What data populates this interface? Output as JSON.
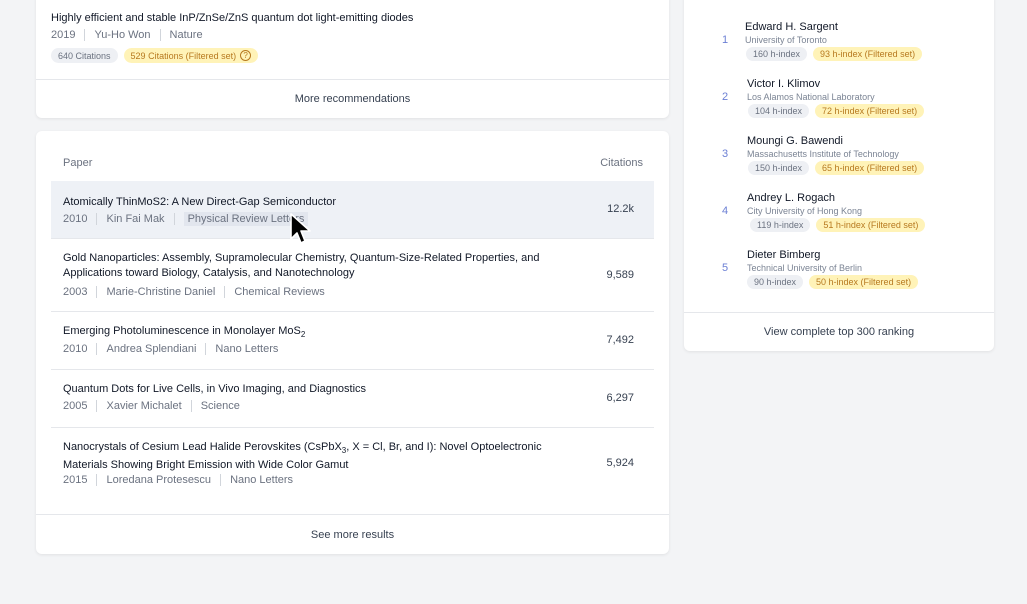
{
  "recommendation": {
    "title": "Highly efficient and stable InP/ZnSe/ZnS quantum dot light-emitting diodes",
    "year": "2019",
    "author": "Yu-Ho Won",
    "venue": "Nature",
    "citations_badge": "640 Citations",
    "filtered_badge": "529 Citations (Filtered set)",
    "help_icon": "?",
    "more_label": "More recommendations"
  },
  "papers": {
    "col_paper": "Paper",
    "col_citations": "Citations",
    "rows": [
      {
        "title": "Atomically ThinMoS2: A New Direct-Gap Semiconductor",
        "year": "2010",
        "author": "Kin Fai Mak",
        "venue": "Physical Review Letters",
        "citations": "12.2k"
      },
      {
        "title": "Gold Nanoparticles: Assembly, Supramolecular Chemistry, Quantum-Size-Related Properties, and Applications toward Biology, Catalysis, and Nanotechnology",
        "year": "2003",
        "author": "Marie-Christine Daniel",
        "venue": "Chemical Reviews",
        "citations": "9,589"
      },
      {
        "title_prefix": "Emerging Photoluminescence in Monolayer MoS",
        "title_sub": "2",
        "year": "2010",
        "author": "Andrea Splendiani",
        "venue": "Nano Letters",
        "citations": "7,492"
      },
      {
        "title": "Quantum Dots for Live Cells, in Vivo Imaging, and Diagnostics",
        "year": "2005",
        "author": "Xavier Michalet",
        "venue": "Science",
        "citations": "6,297"
      },
      {
        "title_line1_a": "Nanocrystals of Cesium Lead Halide Perovskites (CsPbX",
        "title_line1_sub": "3",
        "title_line1_b": ", X = Cl, Br, and I): Novel Optoelectronic",
        "title_line2": "Materials Showing Bright Emission with Wide Color Gamut",
        "year": "2015",
        "author": "Loredana Protesescu",
        "venue": "Nano Letters",
        "citations": "5,924"
      }
    ],
    "see_more_label": "See more results"
  },
  "ranking": {
    "items": [
      {
        "rank": "1",
        "name": "Edward H. Sargent",
        "affiliation": "University of Toronto",
        "hindex": "160 h-index",
        "filtered": "93 h-index (Filtered set)"
      },
      {
        "rank": "2",
        "name": "Victor I. Klimov",
        "affiliation": "Los Alamos National Laboratory",
        "hindex": "104 h-index",
        "filtered": "72 h-index (Filtered set)"
      },
      {
        "rank": "3",
        "name": "Moungi G. Bawendi",
        "affiliation": "Massachusetts Institute of Technology",
        "hindex": "150 h-index",
        "filtered": "65 h-index (Filtered set)"
      },
      {
        "rank": "4",
        "name": "Andrey L. Rogach",
        "affiliation": "City University of Hong Kong",
        "hindex": "119 h-index",
        "filtered": "51 h-index (Filtered set)"
      },
      {
        "rank": "5",
        "name": "Dieter Bimberg",
        "affiliation": "Technical University of Berlin",
        "hindex": "90 h-index",
        "filtered": "50 h-index (Filtered set)"
      }
    ],
    "view_all_label": "View complete top 300 ranking"
  },
  "colors": {
    "page_bg": "#f3f4f6",
    "card_bg": "#ffffff",
    "badge_grey": "#eef0f4",
    "badge_yellow": "#fff3b8",
    "rank_accent": "#6b7fd4",
    "row_highlight": "#eef1f6"
  },
  "icons": {
    "help": "help-circle-icon",
    "cursor": "mouse-pointer-icon"
  }
}
